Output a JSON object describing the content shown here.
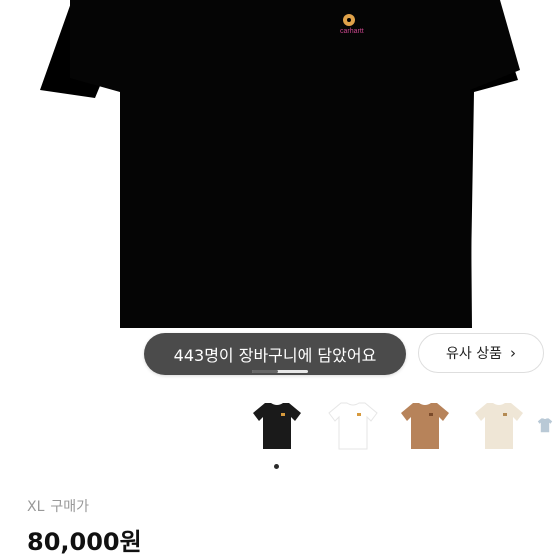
{
  "image": {
    "main_color": "#000000",
    "logo_text": "carhartt"
  },
  "toast": {
    "message": "443명이 장바구니에 담았어요"
  },
  "similar_button": {
    "label": "유사 상품",
    "icon": "chevron-right-icon",
    "chevron": "›"
  },
  "thumbnails": [
    {
      "color": "#1a1a1a"
    },
    {
      "color": "#ffffff"
    },
    {
      "color": "#b7835a"
    },
    {
      "color": "#efe6d6"
    },
    {
      "color": "#b9c9d6"
    }
  ],
  "product": {
    "size": "XL",
    "purchase_label": "구매가",
    "price": "80,000원"
  }
}
